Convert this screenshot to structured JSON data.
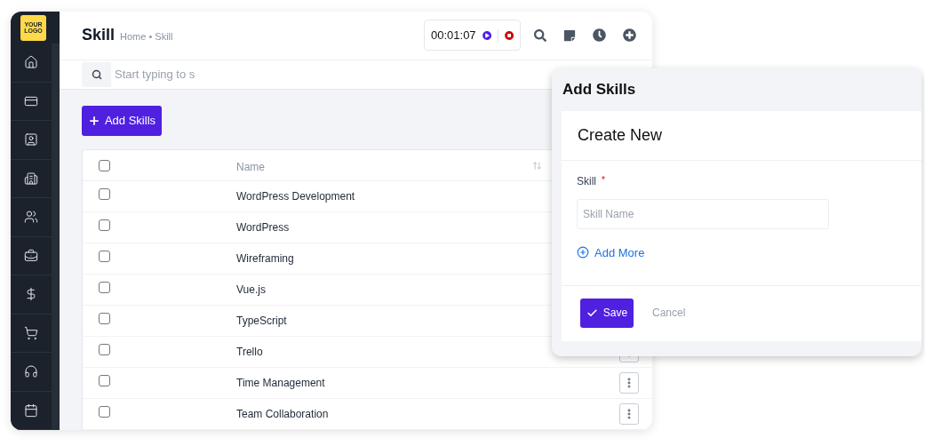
{
  "logo": {
    "text": "YOUR LOGO"
  },
  "header": {
    "title": "Skill",
    "breadcrumb": "Home • Skill",
    "timer": "00:01:07"
  },
  "search": {
    "placeholder": "Start typing to s"
  },
  "add_button": "Add Skills",
  "table": {
    "columns": [
      "Name"
    ],
    "all_checked": false,
    "rows": [
      {
        "name": "WordPress Development",
        "checked": false
      },
      {
        "name": "WordPress",
        "checked": false
      },
      {
        "name": "Wireframing",
        "checked": false
      },
      {
        "name": "Vue.js",
        "checked": false
      },
      {
        "name": "TypeScript",
        "checked": false
      },
      {
        "name": "Trello",
        "checked": false,
        "has_menu": true
      },
      {
        "name": "Time Management",
        "checked": false,
        "has_menu": true
      },
      {
        "name": "Team Collaboration",
        "checked": false,
        "has_menu": true
      }
    ]
  },
  "dialog": {
    "title": "Add Skills",
    "subtitle": "Create New",
    "field_label": "Skill",
    "required_mark": "*",
    "placeholder": "Skill Name",
    "add_more": "Add More",
    "save": "Save",
    "cancel": "Cancel"
  }
}
